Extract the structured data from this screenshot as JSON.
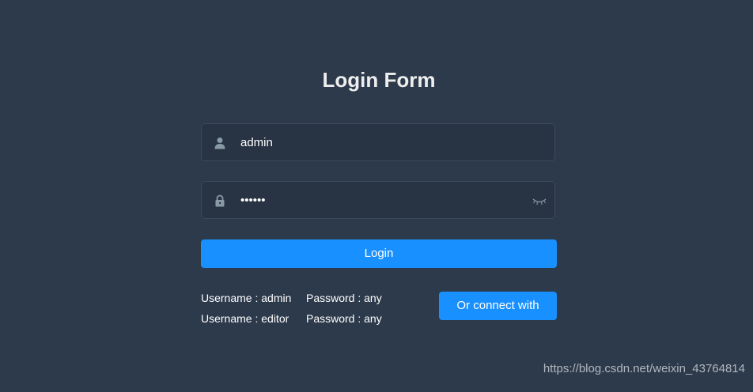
{
  "form": {
    "title": "Login Form",
    "username": {
      "value": "admin",
      "icon": "user-icon"
    },
    "password": {
      "value": "••••••",
      "icon": "lock-icon",
      "toggle_icon": "eye-closed-icon"
    },
    "login_label": "Login"
  },
  "tips": [
    {
      "username": "Username : admin",
      "password": "Password : any"
    },
    {
      "username": "Username : editor",
      "password": "Password : any"
    }
  ],
  "connect_label": "Or connect with",
  "watermark": "https://blog.csdn.net/weixin_43764814",
  "colors": {
    "background": "#2d3a4b",
    "input_background": "#283443",
    "accent": "#1890ff",
    "icon": "#889aa4"
  }
}
